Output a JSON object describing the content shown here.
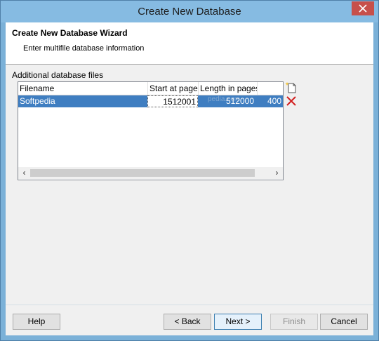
{
  "window": {
    "title": "Create New Database"
  },
  "header": {
    "title": "Create New Database Wizard",
    "subtitle": "Enter multifile database information"
  },
  "group": {
    "label": "Additional database files"
  },
  "table": {
    "columns": [
      "Filename",
      "Start at page",
      "Length in pages"
    ],
    "rows": [
      {
        "filename": "Softpedia",
        "start": "1512001",
        "length": "512000",
        "extra": "400"
      }
    ],
    "watermark": "pedia.com"
  },
  "icons": {
    "add": "new-file-icon",
    "delete": "delete-x-icon",
    "close": "close-icon",
    "scroll_left": "‹",
    "scroll_right": "›"
  },
  "buttons": {
    "help": "Help",
    "back": "< Back",
    "next": "Next >",
    "finish": "Finish",
    "cancel": "Cancel"
  },
  "colors": {
    "title_bar": "#86bbe2",
    "selection": "#3f7ec1",
    "close_button": "#c7504b",
    "delete_icon": "#d22020"
  }
}
